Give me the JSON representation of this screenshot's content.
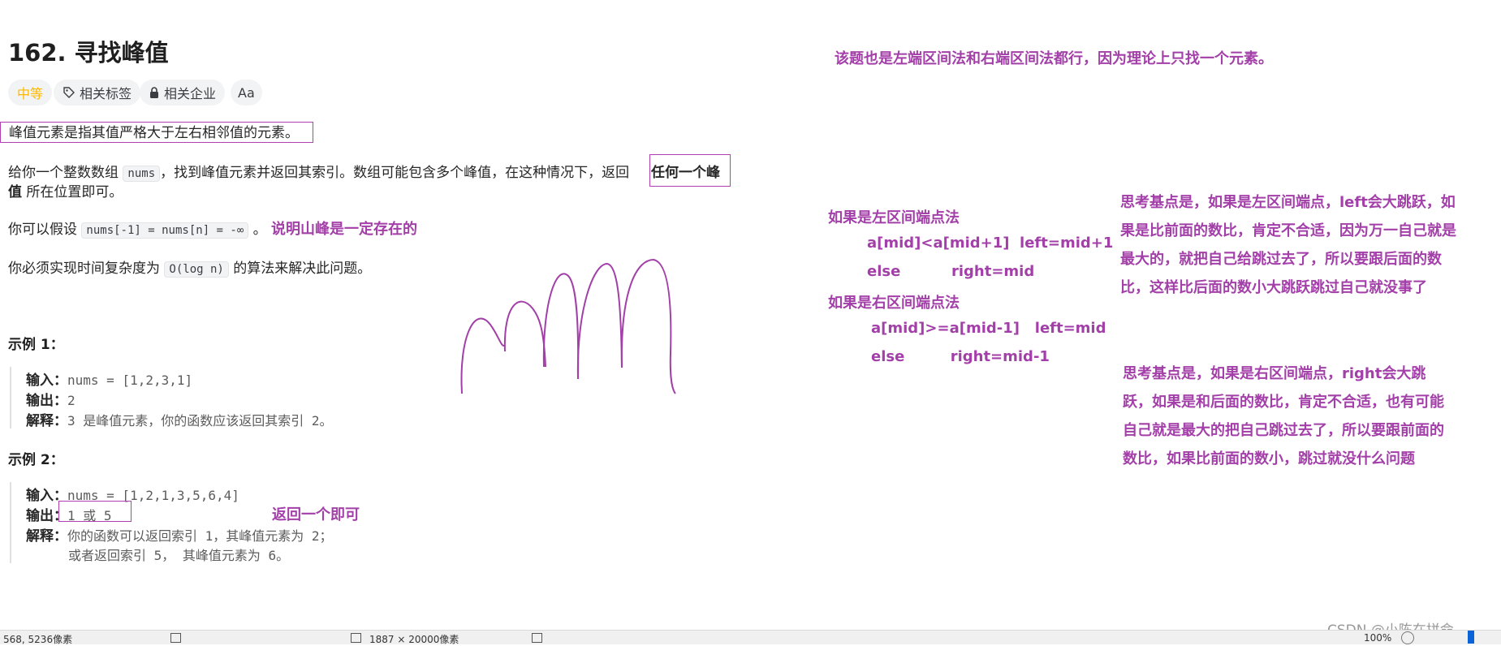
{
  "problem": {
    "title": "162. 寻找峰值",
    "tags": {
      "difficulty": "中等",
      "related_tags": "相关标签",
      "related_companies": "相关企业",
      "font_toggle": "Aa"
    },
    "desc1": "峰值元素是指其值严格大于左右相邻值的元素。",
    "desc2_a": "给你一个整数数组 ",
    "desc2_code": "nums",
    "desc2_b": "，找到峰值元素并返回其索引。数组可能包含多个峰值，在这种情况下，返回 ",
    "desc2_bold_1": "任何一个峰",
    "desc2_bold_2": "值",
    "desc2_c": " 所在位置即可。",
    "assume_a": "你可以假设 ",
    "assume_code": "nums[-1] = nums[n] = -∞",
    "assume_b": " 。",
    "complexity_a": "你必须实现时间复杂度为 ",
    "complexity_code": "O(log n)",
    "complexity_b": " 的算法来解决此问题。"
  },
  "example1": {
    "title": "示例 1：",
    "input_label": "输入：",
    "input_value": "nums = [1,2,3,1]",
    "output_label": "输出：",
    "output_value": "2",
    "explain_label": "解释：",
    "explain_value": "3 是峰值元素，你的函数应该返回其索引 2。"
  },
  "example2": {
    "title": "示例 2：",
    "input_label": "输入：",
    "input_value": "nums = [1,2,1,3,5,6,4]",
    "output_label": "输出：",
    "output_value": "1 或 5",
    "explain_label": "解释：",
    "explain_line1": "你的函数可以返回索引 1，其峰值元素为 2；",
    "explain_line2": "或者返回索引 5， 其峰值元素为 6。"
  },
  "notes": {
    "mountain": "说明山峰是一定存在的",
    "return_one": "返回一个即可",
    "top": "该题也是左端区间法和右端区间法都行，因为理论上只找一个元素。",
    "left_title": "如果是左区间端点法",
    "left_cond": "a[mid]<a[mid+1]  left=mid+1",
    "left_else": "else          right=mid",
    "right_title": "如果是右区间端点法",
    "right_cond": "a[mid]>=a[mid-1]   left=mid",
    "right_else": "else         right=mid-1",
    "left_reason": [
      "思考基点是，如果是左区间端点，left会大跳跃，如",
      "果是比前面的数比，肯定不合适，因为万一自己就是",
      "最大的，就把自己给跳过去了，所以要跟后面的数",
      "比，这样比后面的数小大跳跃跳过自己就没事了"
    ],
    "right_reason": [
      "思考基点是，如果是右区间端点，right会大跳",
      "跃，如果是和后面的数比，肯定不合适，也有可能",
      "自己就是最大的把自己跳过去了，所以要跟前面的",
      "数比，如果比前面的数小，跳过就没什么问题"
    ]
  },
  "statusbar": {
    "cursor": "568, 5236像素",
    "size": "1887 × 20000像素",
    "zoom": "100%"
  },
  "watermark": "CSDN @小陈在拼命",
  "colors": {
    "annotation": "#a33fa8",
    "difficulty": "#ffb800"
  }
}
